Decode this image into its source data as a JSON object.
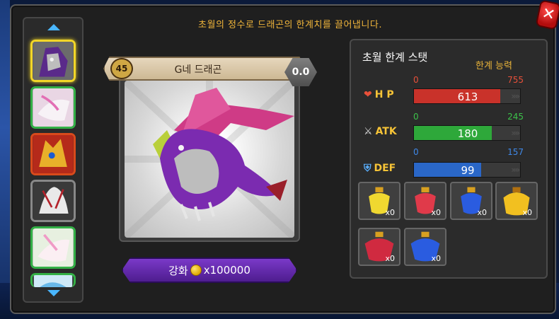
{
  "header": {
    "subtitle": "초월의 정수로 드래곤의 한계치를 끌어냅니다."
  },
  "dragon": {
    "name": "G네 드래곤",
    "level": "45",
    "transcend": "0.0"
  },
  "enhance": {
    "label": "강화",
    "cost": "x100000"
  },
  "stats_panel": {
    "title": "초월 한계 스탯",
    "ability_label": "한계 능력",
    "stats": [
      {
        "label": "H P",
        "min": "0",
        "max": "755",
        "value": "613",
        "fraction": 0.81,
        "color": "#c9322a",
        "min_color": "#e8503a",
        "max_color": "#e8503a"
      },
      {
        "label": "ATK",
        "min": "0",
        "max": "245",
        "value": "180",
        "fraction": 0.73,
        "color": "#2ea83a",
        "min_color": "#3cc24a",
        "max_color": "#3cc24a"
      },
      {
        "label": "DEF",
        "min": "0",
        "max": "157",
        "value": "99",
        "fraction": 0.63,
        "color": "#2a67c8",
        "min_color": "#3f88e8",
        "max_color": "#3f88e8"
      }
    ]
  },
  "potions": [
    {
      "name": "yellow-potion",
      "count": "x0"
    },
    {
      "name": "red-potion",
      "count": "x0"
    },
    {
      "name": "blue-potion",
      "count": "x0"
    },
    {
      "name": "gold-potion",
      "count": "x0"
    },
    {
      "name": "red-large-potion",
      "count": "x0"
    },
    {
      "name": "blue-large-potion",
      "count": "x0"
    }
  ]
}
